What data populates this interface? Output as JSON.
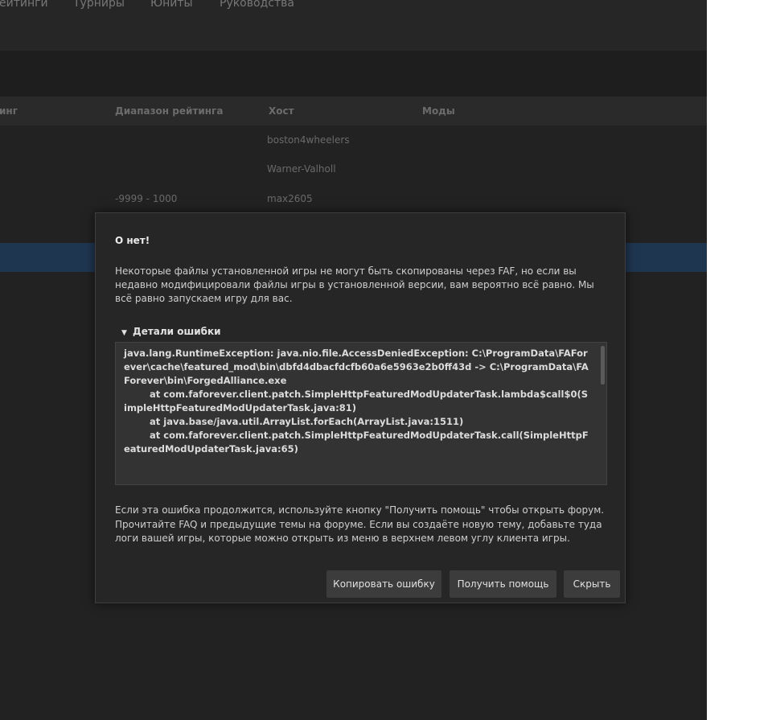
{
  "nav": {
    "items": [
      "ейтинги",
      "Турниры",
      "Юниты",
      "Руководства"
    ]
  },
  "table": {
    "headers": [
      "инг",
      "Диапазон рейтинга",
      "Хост",
      "Моды"
    ],
    "rows": [
      {
        "rating_range": "",
        "host": "boston4wheelers"
      },
      {
        "rating_range": "",
        "host": "Warner-Valholl"
      },
      {
        "rating_range": "-9999 - 1000",
        "host": "max2605"
      }
    ]
  },
  "dialog": {
    "title": "О нет!",
    "message": "Некоторые файлы установленной игры не могут быть скопированы через FAF, но если вы недавно модифицировали файлы игры в установленной версии, вам вероятно всё равно. Мы всё равно запускаем игру для вас.",
    "details_label": "Детали ошибки",
    "error_text": "java.lang.RuntimeException: java.nio.file.AccessDeniedException: C:\\ProgramData\\FAForever\\cache\\featured_mod\\bin\\dbfd4dbacfdcfb60a6e5963e2b0ff43d -> C:\\ProgramData\\FAForever\\bin\\ForgedAlliance.exe\n\tat com.faforever.client.patch.SimpleHttpFeaturedModUpdaterTask.lambda$call$0(SimpleHttpFeaturedModUpdaterTask.java:81)\n\tat java.base/java.util.ArrayList.forEach(ArrayList.java:1511)\n\tat com.faforever.client.patch.SimpleHttpFeaturedModUpdaterTask.call(SimpleHttpFeaturedModUpdaterTask.java:65)",
    "footer": "Если эта ошибка продолжится, используйте кнопку \"Получить помощь\" чтобы открыть форум. Прочитайте FAQ и предыдущие темы на форуме. Если вы создаёте новую тему, добавьте туда логи вашей игры, которые можно открыть из меню в верхнем левом углу клиента игры.",
    "buttons": {
      "copy": "Копировать ошибку",
      "help": "Получить помощь",
      "hide": "Скрыть"
    }
  },
  "colors": {
    "background": "#202020",
    "dialog": "#262626",
    "selected_row": "#1f3650",
    "button": "#3c3c3c"
  }
}
